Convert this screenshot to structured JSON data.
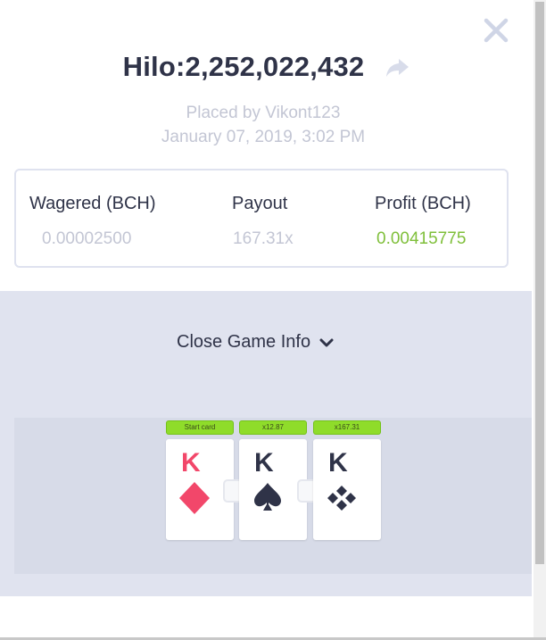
{
  "header": {
    "title": "Hilo:2,252,022,432",
    "placed_by": "Placed by Vikont123",
    "date": "January 07, 2019, 3:02 PM"
  },
  "stats": {
    "wagered": {
      "label": "Wagered (BCH)",
      "value": "0.00002500"
    },
    "payout": {
      "label": "Payout",
      "value": "167.31x"
    },
    "profit": {
      "label": "Profit (BCH)",
      "value": "0.00415775"
    }
  },
  "toggle": {
    "label": "Close Game Info"
  },
  "cards": [
    {
      "badge": "Start card",
      "rank": "K",
      "suit": "diamond-icon",
      "color": "#f2476a"
    },
    {
      "badge": "x12.87",
      "rank": "K",
      "suit": "spade-icon",
      "color": "#2f3348"
    },
    {
      "badge": "x167.31",
      "rank": "K",
      "suit": "club-icon",
      "color": "#2f3348"
    }
  ],
  "colors": {
    "text": "#2f3348",
    "muted": "#c3c6d4",
    "profit": "#7fbf3a",
    "badge": "#8fdc2a",
    "diamond": "#f2476a"
  }
}
